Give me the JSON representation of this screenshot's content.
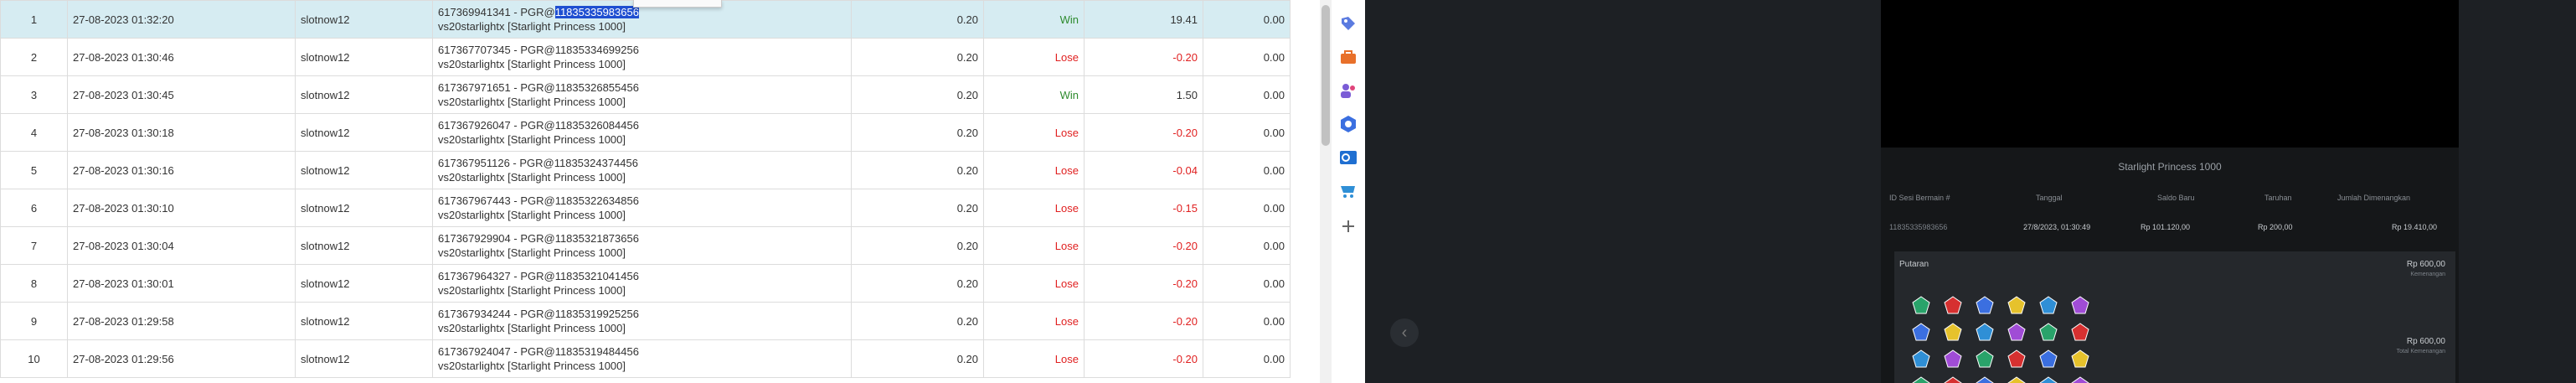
{
  "rows": [
    {
      "no": "1",
      "date": "27-08-2023 01:32:20",
      "user": "slotnow12",
      "tx_prefix": "617369941341 - PGR@",
      "tx_id": "11835335983656",
      "game": "vs20starlightx [Starlight Princess 1000]",
      "bet": "0.20",
      "status": "Win",
      "win": "19.41",
      "balance": "0.00"
    },
    {
      "no": "2",
      "date": "27-08-2023 01:30:46",
      "user": "slotnow12",
      "tx_prefix": "617367707345 - PGR@",
      "tx_id": "11835334699256",
      "game": "vs20starlightx [Starlight Princess 1000]",
      "bet": "0.20",
      "status": "Lose",
      "win": "-0.20",
      "balance": "0.00"
    },
    {
      "no": "3",
      "date": "27-08-2023 01:30:45",
      "user": "slotnow12",
      "tx_prefix": "617367971651 - PGR@",
      "tx_id": "11835326855456",
      "game": "vs20starlightx [Starlight Princess 1000]",
      "bet": "0.20",
      "status": "Win",
      "win": "1.50",
      "balance": "0.00"
    },
    {
      "no": "4",
      "date": "27-08-2023 01:30:18",
      "user": "slotnow12",
      "tx_prefix": "617367926047 - PGR@",
      "tx_id": "11835326084456",
      "game": "vs20starlightx [Starlight Princess 1000]",
      "bet": "0.20",
      "status": "Lose",
      "win": "-0.20",
      "balance": "0.00"
    },
    {
      "no": "5",
      "date": "27-08-2023 01:30:16",
      "user": "slotnow12",
      "tx_prefix": "617367951126 - PGR@",
      "tx_id": "11835324374456",
      "game": "vs20starlightx [Starlight Princess 1000]",
      "bet": "0.20",
      "status": "Lose",
      "win": "-0.04",
      "balance": "0.00"
    },
    {
      "no": "6",
      "date": "27-08-2023 01:30:10",
      "user": "slotnow12",
      "tx_prefix": "617367967443 - PGR@",
      "tx_id": "11835322634856",
      "game": "vs20starlightx [Starlight Princess 1000]",
      "bet": "0.20",
      "status": "Lose",
      "win": "-0.15",
      "balance": "0.00"
    },
    {
      "no": "7",
      "date": "27-08-2023 01:30:04",
      "user": "slotnow12",
      "tx_prefix": "617367929904 - PGR@",
      "tx_id": "11835321873656",
      "game": "vs20starlightx [Starlight Princess 1000]",
      "bet": "0.20",
      "status": "Lose",
      "win": "-0.20",
      "balance": "0.00"
    },
    {
      "no": "8",
      "date": "27-08-2023 01:30:01",
      "user": "slotnow12",
      "tx_prefix": "617367964327 - PGR@",
      "tx_id": "11835321041456",
      "game": "vs20starlightx [Starlight Princess 1000]",
      "bet": "0.20",
      "status": "Lose",
      "win": "-0.20",
      "balance": "0.00"
    },
    {
      "no": "9",
      "date": "27-08-2023 01:29:58",
      "user": "slotnow12",
      "tx_prefix": "617367934244 - PGR@",
      "tx_id": "11835319925256",
      "game": "vs20starlightx [Starlight Princess 1000]",
      "bet": "0.20",
      "status": "Lose",
      "win": "-0.20",
      "balance": "0.00"
    },
    {
      "no": "10",
      "date": "27-08-2023 01:29:56",
      "user": "slotnow12",
      "tx_prefix": "617367924047 - PGR@",
      "tx_id": "11835319484456",
      "game": "vs20starlightx [Starlight Princess 1000]",
      "bet": "0.20",
      "status": "Lose",
      "win": "-0.20",
      "balance": "0.00"
    }
  ],
  "side_icons": [
    "tag-icon",
    "toolbox-icon",
    "people-icon",
    "hexagon-icon",
    "outlook-icon",
    "cart-icon",
    "plus-icon"
  ],
  "game_panel": {
    "title": "Starlight Princess 1000",
    "headers": {
      "id": "ID Sesi Bermain #",
      "date": "Tanggal",
      "balance": "Saldo Baru",
      "bet": "Taruhan",
      "win": "Jumlah Dimenangkan"
    },
    "row": {
      "id": "11835335983656",
      "date": "27/8/2023, 01:30:49",
      "balance": "Rp 101.120,00",
      "bet": "Rp 200,00",
      "win": "Rp 19.410,00"
    },
    "spin_label": "Putaran",
    "amount1": "Rp 600,00",
    "amount1_sub": "Kemenangan",
    "amount2": "Rp 600,00",
    "amount2_sub": "Total Kemenangan"
  },
  "colors": {
    "win": "#2e8b2e",
    "lose": "#e02020",
    "selected_row": "#d6ecf2",
    "highlight": "#1f4fd1"
  }
}
